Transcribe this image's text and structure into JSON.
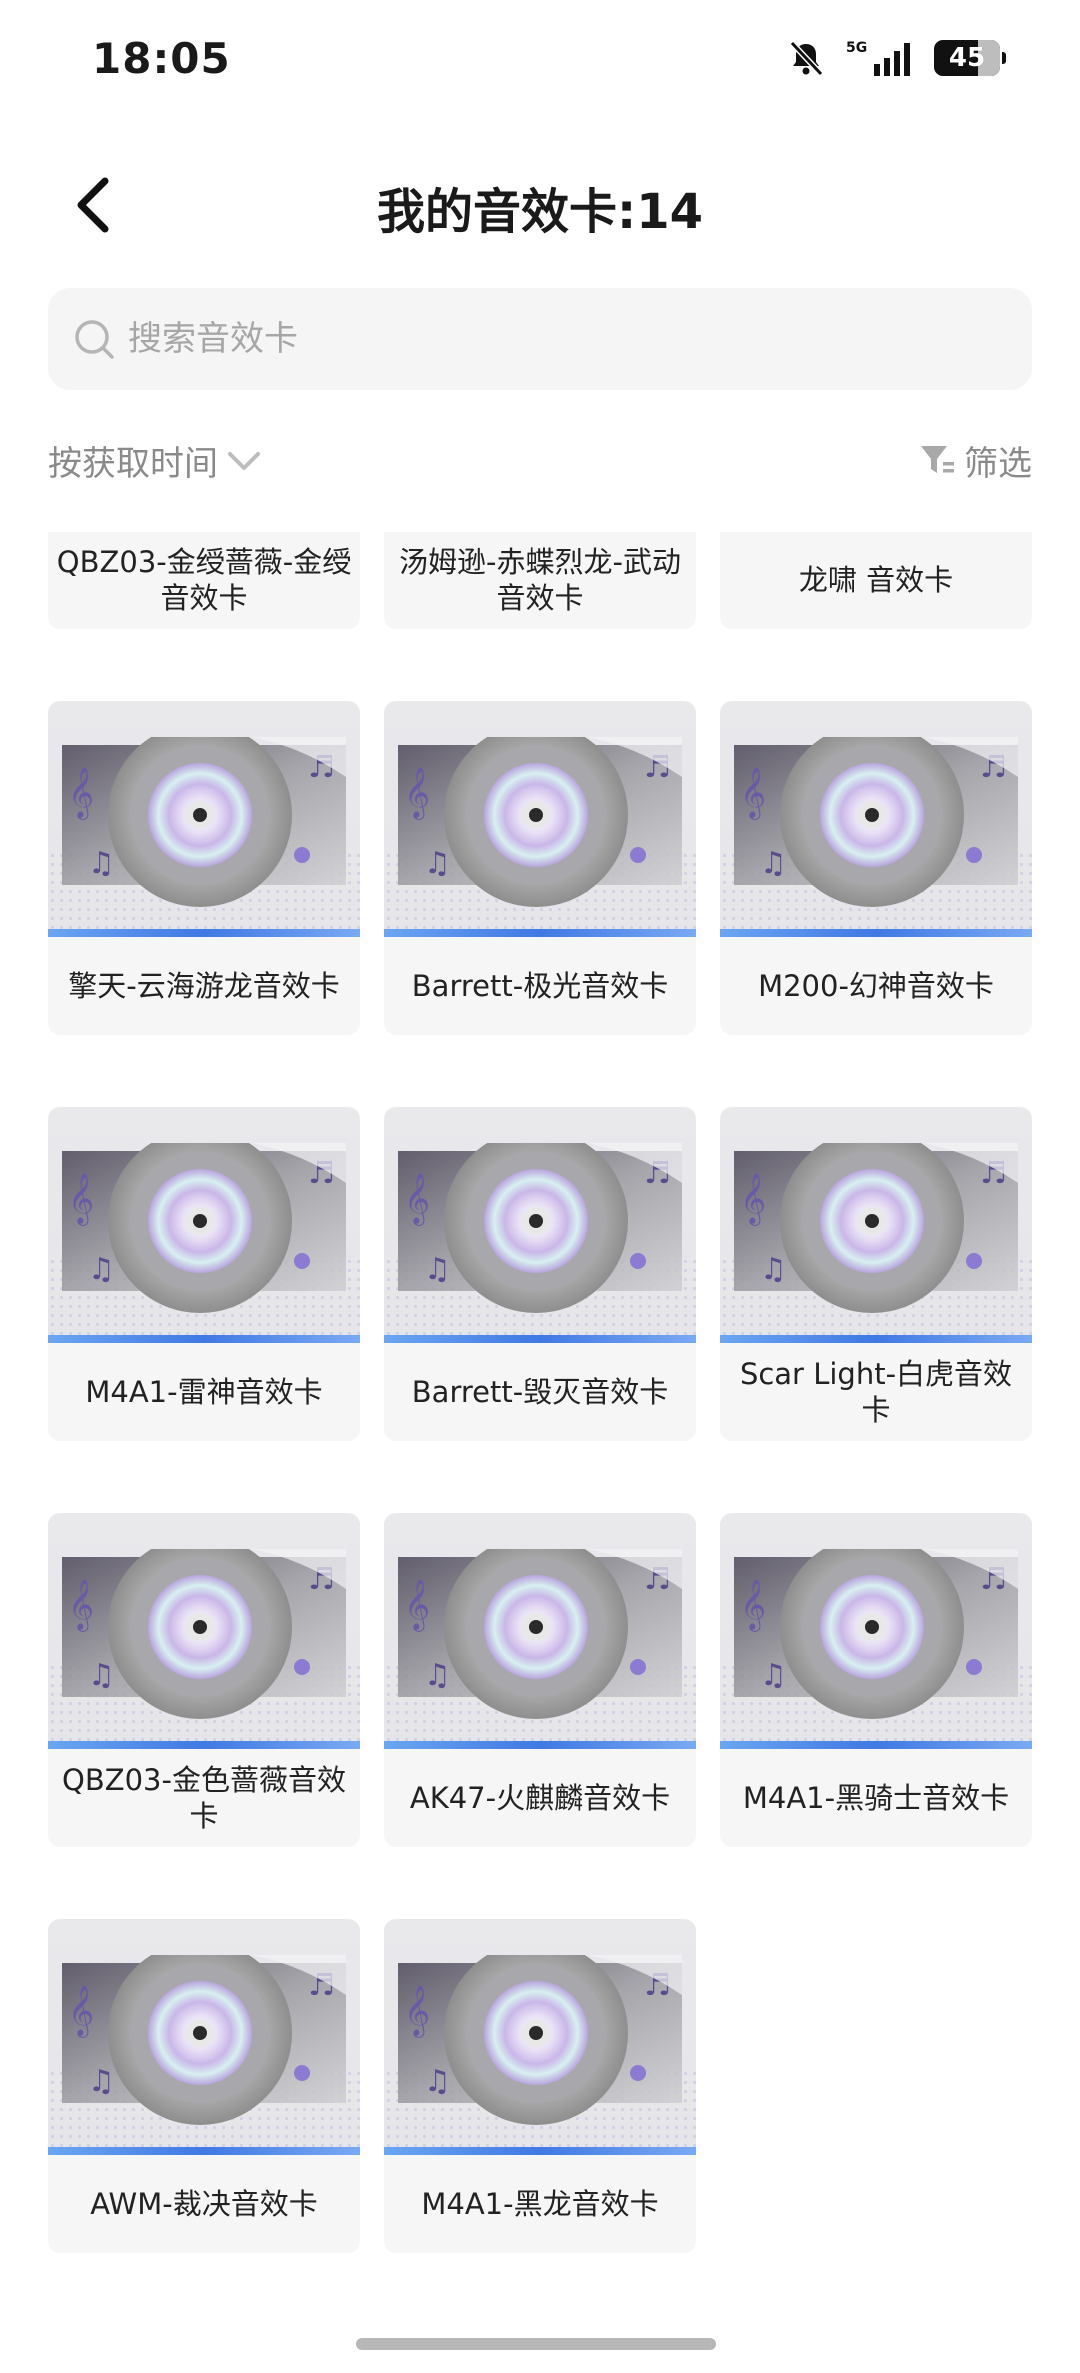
{
  "status_bar": {
    "time": "18:05",
    "network": "5G",
    "battery": "45",
    "icons": [
      "mute-bell-icon",
      "signal-icon",
      "battery-icon"
    ]
  },
  "header": {
    "title": "我的音效卡:14",
    "back_icon": "chevron-left-icon"
  },
  "search": {
    "placeholder": "搜索音效卡",
    "value": ""
  },
  "toolbar": {
    "sort_label": "按获取时间",
    "filter_label": "筛选"
  },
  "cards": [
    {
      "name": "QBZ03-金绶蔷薇-金绶音效卡"
    },
    {
      "name": "汤姆逊-赤蝶烈龙-武动音效卡"
    },
    {
      "name": "龙啸 音效卡"
    },
    {
      "name": "擎天-云海游龙音效卡"
    },
    {
      "name": "Barrett-极光音效卡"
    },
    {
      "name": "M200-幻神音效卡"
    },
    {
      "name": "M4A1-雷神音效卡"
    },
    {
      "name": "Barrett-毁灭音效卡"
    },
    {
      "name": "Scar Light-白虎音效卡"
    },
    {
      "name": "QBZ03-金色蔷薇音效卡"
    },
    {
      "name": "AK47-火麒麟音效卡"
    },
    {
      "name": "M4A1-黑骑士音效卡"
    },
    {
      "name": "AWM-裁决音效卡"
    },
    {
      "name": "M4A1-黑龙音效卡"
    }
  ],
  "colors": {
    "accent_bar": "#3f79e3",
    "card_bg": "#f6f6f6",
    "muted_text": "#8a8a8a"
  }
}
